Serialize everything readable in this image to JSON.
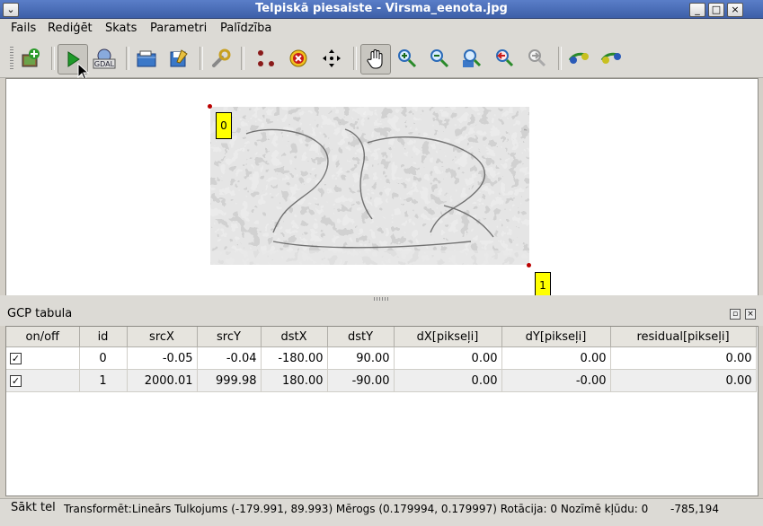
{
  "window": {
    "title": "Telpiskā piesaiste - Virsma_eenota.jpg"
  },
  "menubar": {
    "items": [
      "Fails",
      "Rediģēt",
      "Skats",
      "Parametri",
      "Palīdzība"
    ]
  },
  "toolbar": {
    "icons": [
      "add-raster-icon",
      "start-georeferencing-icon",
      "gdal-script-icon",
      "open-gcp-icon",
      "save-gcp-icon",
      "settings-icon",
      "add-point-icon",
      "delete-point-icon",
      "move-point-icon",
      "pan-icon",
      "zoom-in-icon",
      "zoom-out-icon",
      "zoom-to-layer-icon",
      "zoom-last-icon",
      "zoom-next-icon",
      "link-georef-to-qgis-icon",
      "link-qgis-to-georef-icon"
    ],
    "active": "pan-icon"
  },
  "canvas": {
    "gcp_labels": [
      "0",
      "1"
    ]
  },
  "dock": {
    "title": "GCP tabula",
    "columns": [
      "on/off",
      "id",
      "srcX",
      "srcY",
      "dstX",
      "dstY",
      "dX[pikseļi]",
      "dY[pikseļi]",
      "residual[pikseļi]"
    ],
    "rows": [
      {
        "checked": true,
        "id": "0",
        "srcX": "-0.05",
        "srcY": "-0.04",
        "dstX": "-180.00",
        "dstY": "90.00",
        "dX": "0.00",
        "dY": "0.00",
        "residual": "0.00"
      },
      {
        "checked": true,
        "id": "1",
        "srcX": "2000.01",
        "srcY": "999.98",
        "dstX": "180.00",
        "dstY": "-90.00",
        "dX": "0.00",
        "dY": "-0.00",
        "residual": "0.00"
      }
    ]
  },
  "status": {
    "start": "Sākt tel",
    "info": "Transformēt:Lineārs Tulkojums (-179.991, 89.993) Mērogs (0.179994, 0.179997) Rotācija: 0 Nozīmē kļūdu: 0",
    "coords": "-785,194"
  },
  "colors": {
    "titlebar": "#4a6cb8",
    "gcp_label": "#ffff00",
    "gcp_point": "#b00000",
    "active_tool": "#c8c6c0"
  }
}
